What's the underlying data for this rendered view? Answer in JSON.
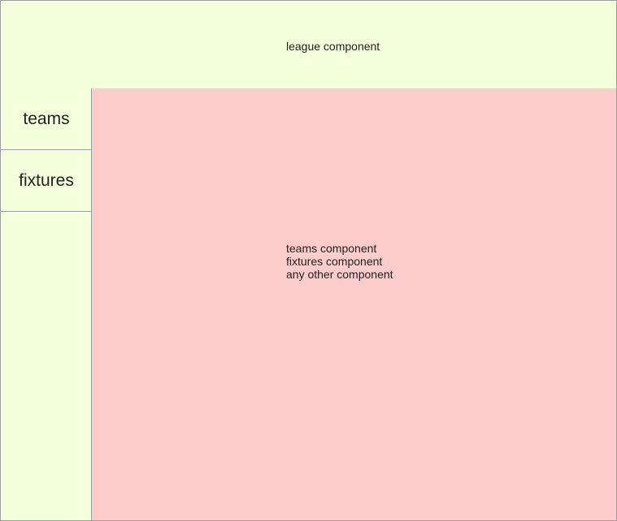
{
  "header": {
    "label": "league component"
  },
  "sidebar": {
    "items": [
      {
        "label": "teams"
      },
      {
        "label": "fixtures"
      }
    ]
  },
  "content": {
    "lines": [
      "teams component",
      "fixtures component",
      "any other component"
    ]
  },
  "colors": {
    "header_bg": "#f4ffdc",
    "sidebar_bg": "#f4ffdc",
    "content_bg": "#ffcccc",
    "border": "#9e9e9e"
  }
}
